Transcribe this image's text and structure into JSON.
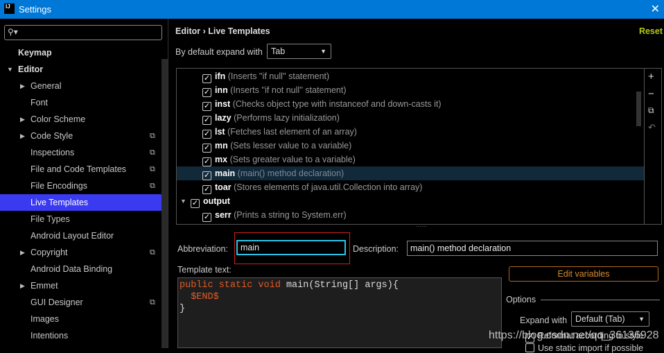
{
  "window": {
    "title": "Settings",
    "app_icon": "IJ",
    "close": "✕"
  },
  "sidebar": {
    "search_placeholder": "",
    "items": [
      {
        "label": "Keymap",
        "level": 0,
        "bold": true
      },
      {
        "label": "Editor",
        "level": 0,
        "bold": true,
        "expanded": true
      },
      {
        "label": "General",
        "level": 1,
        "collapsed": true
      },
      {
        "label": "Font",
        "level": 1
      },
      {
        "label": "Color Scheme",
        "level": 1,
        "collapsed": true
      },
      {
        "label": "Code Style",
        "level": 1,
        "collapsed": true,
        "copy": true
      },
      {
        "label": "Inspections",
        "level": 1,
        "copy": true
      },
      {
        "label": "File and Code Templates",
        "level": 1,
        "copy": true
      },
      {
        "label": "File Encodings",
        "level": 1,
        "copy": true
      },
      {
        "label": "Live Templates",
        "level": 1,
        "selected": true
      },
      {
        "label": "File Types",
        "level": 1
      },
      {
        "label": "Android Layout Editor",
        "level": 1
      },
      {
        "label": "Copyright",
        "level": 1,
        "collapsed": true,
        "copy": true
      },
      {
        "label": "Android Data Binding",
        "level": 1
      },
      {
        "label": "Emmet",
        "level": 1,
        "collapsed": true
      },
      {
        "label": "GUI Designer",
        "level": 1,
        "copy": true
      },
      {
        "label": "Images",
        "level": 1
      },
      {
        "label": "Intentions",
        "level": 1
      }
    ]
  },
  "main": {
    "breadcrumb": "Editor  ›  Live Templates",
    "reset": "Reset",
    "expand_label": "By default expand with",
    "expand_value": "Tab",
    "templates": [
      {
        "abbr": "ifn",
        "desc": "(Inserts ''if null'' statement)",
        "checked": true
      },
      {
        "abbr": "inn",
        "desc": "(Inserts ''if not null'' statement)",
        "checked": true
      },
      {
        "abbr": "inst",
        "desc": "(Checks object type with instanceof and down-casts it)",
        "checked": true
      },
      {
        "abbr": "lazy",
        "desc": "(Performs lazy initialization)",
        "checked": true
      },
      {
        "abbr": "lst",
        "desc": "(Fetches last element of an array)",
        "checked": true
      },
      {
        "abbr": "mn",
        "desc": "(Sets lesser value to a variable)",
        "checked": true
      },
      {
        "abbr": "mx",
        "desc": "(Sets greater value to a variable)",
        "checked": true
      },
      {
        "abbr": "main",
        "desc": "(main() method declaration)",
        "checked": true,
        "selected": true
      },
      {
        "abbr": "toar",
        "desc": "(Stores elements of java.util.Collection into array)",
        "checked": true
      },
      {
        "abbr": "output",
        "desc": "",
        "checked": true,
        "group": true
      },
      {
        "abbr": "serr",
        "desc": "(Prints a string to System.err)",
        "checked": true
      }
    ],
    "tools": [
      "+",
      "−",
      "⧉",
      "↶"
    ],
    "abbreviation_label": "Abbreviation:",
    "abbreviation_value": "main",
    "description_label": "Description:",
    "description_value": "main() method declaration",
    "template_text_label": "Template text:",
    "template_lines": [
      [
        "public static void ",
        "main(String[] args){"
      ],
      [
        "  $END$",
        ""
      ],
      [
        "}",
        ""
      ]
    ],
    "edit_variables": "Edit variables",
    "options_label": "Options",
    "expand_with_label": "Expand with",
    "expand_with_value": "Default (Tab)",
    "option_reformat": "Reformat according to style",
    "option_static": "Use static import if possible"
  },
  "watermark": "https://blog.csdn.net/qq_36136928"
}
